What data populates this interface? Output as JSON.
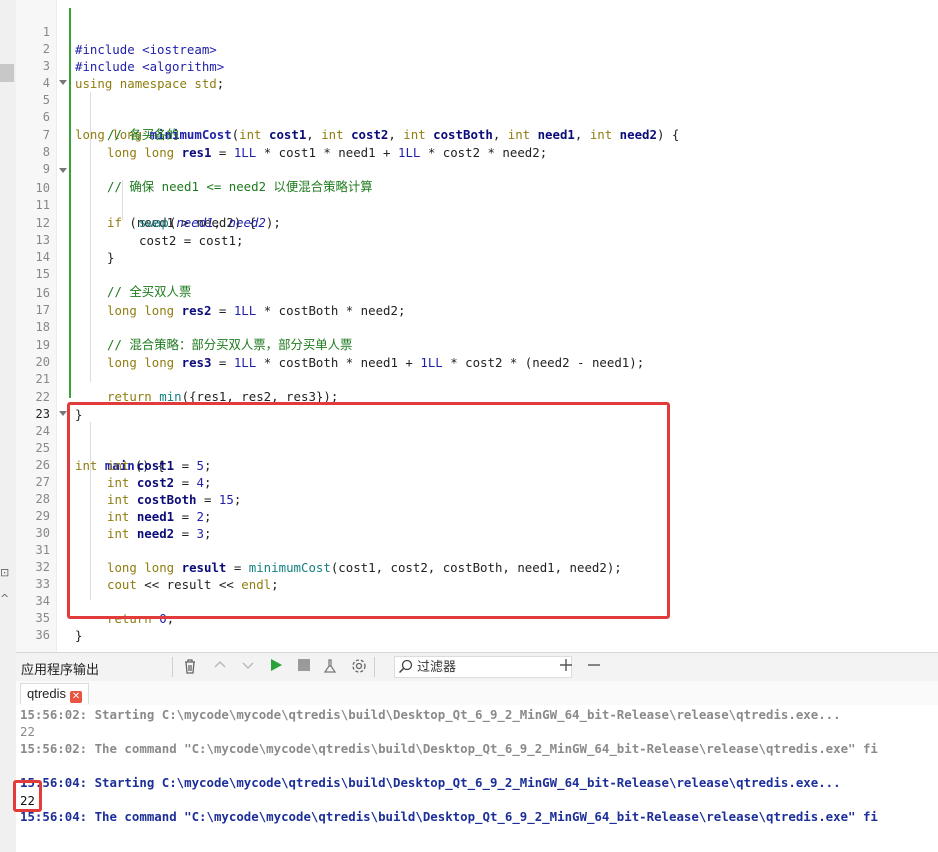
{
  "editor": {
    "current_line": 23,
    "line_numbers": [
      "1",
      "2",
      "3",
      "4",
      "5",
      "6",
      "7",
      "8",
      "9",
      "10",
      "11",
      "12",
      "13",
      "14",
      "15",
      "16",
      "17",
      "18",
      "19",
      "20",
      "21",
      "22",
      "23",
      "24",
      "25",
      "26",
      "27",
      "28",
      "29",
      "30",
      "31",
      "32",
      "33",
      "34",
      "35",
      "36"
    ],
    "code": {
      "l1": "#include <iostream>",
      "l2": "#include <algorithm>",
      "l3_a": "using",
      "l3_b": " ",
      "l3_c": "namespace",
      "l3_d": " ",
      "l3_e": "std",
      "l3_f": ";",
      "l5_a": "long long ",
      "l5_b": "minimumCost",
      "l5_c": "(",
      "l5_d": "int ",
      "l5_e": "cost1",
      "l5_f": ", ",
      "l5_g": "int ",
      "l5_h": "cost2",
      "l5_i": ", ",
      "l5_j": "int ",
      "l5_k": "costBoth",
      "l5_l": ", ",
      "l5_m": "int ",
      "l5_n": "need1",
      "l5_o": ", ",
      "l5_p": "int ",
      "l5_q": "need2",
      "l5_r": ") {",
      "l6": "// 各买各的",
      "l7_a": "long long ",
      "l7_b": "res1",
      "l7_c": " = ",
      "l7_d": "1LL",
      "l7_e": " * cost1 * need1 + ",
      "l7_f": "1LL",
      "l7_g": " * cost2 * need2;",
      "l9": "// 确保 need1 <= need2 以便混合策略计算",
      "l10_a": "if",
      "l10_b": " (need1 > need2) {",
      "l11_a": "swap",
      "l11_b": "(",
      "l11_c": "need1",
      "l11_d": ", ",
      "l11_e": "need2",
      "l11_f": ");",
      "l12": "cost2 = cost1;",
      "l13": "}",
      "l15": "// 全买双人票",
      "l16_a": "long long ",
      "l16_b": "res2",
      "l16_c": " = ",
      "l16_d": "1LL",
      "l16_e": " * costBoth * need2;",
      "l18": "// 混合策略：部分买双人票，部分买单人票",
      "l19_a": "long long ",
      "l19_b": "res3",
      "l19_c": " = ",
      "l19_d": "1LL",
      "l19_e": " * costBoth * need1 + ",
      "l19_f": "1LL",
      "l19_g": " * cost2 * (need2 - need1);",
      "l21_a": "return",
      "l21_b": " ",
      "l21_c": "min",
      "l21_d": "({res1, res2, res3});",
      "l22": "}",
      "l24_a": "int ",
      "l24_b": "main",
      "l24_c": "() {",
      "l25_a": "int ",
      "l25_b": "cost1",
      "l25_c": " = ",
      "l25_d": "5",
      "l25_e": ";",
      "l26_a": "int ",
      "l26_b": "cost2",
      "l26_c": " = ",
      "l26_d": "4",
      "l26_e": ";",
      "l27_a": "int ",
      "l27_b": "costBoth",
      "l27_c": " = ",
      "l27_d": "15",
      "l27_e": ";",
      "l28_a": "int ",
      "l28_b": "need1",
      "l28_c": " = ",
      "l28_d": "2",
      "l28_e": ";",
      "l29_a": "int ",
      "l29_b": "need2",
      "l29_c": " = ",
      "l29_d": "3",
      "l29_e": ";",
      "l31_a": "long long ",
      "l31_b": "result",
      "l31_c": " = ",
      "l31_d": "minimumCost",
      "l31_e": "(cost1, cost2, costBoth, need1, need2);",
      "l32_a": "cout",
      "l32_b": " << result << ",
      "l32_c": "endl",
      "l32_d": ";",
      "l34_a": "return",
      "l34_b": " ",
      "l34_c": "0",
      "l34_d": ";",
      "l35": "}"
    }
  },
  "output_panel": {
    "title": "应用程序输出",
    "filter_placeholder": "过滤器",
    "tab_label": "qtredis",
    "tab_close": "✕",
    "lines": [
      "15:56:02: Starting C:\\mycode\\mycode\\qtredis\\build\\Desktop_Qt_6_9_2_MinGW_64_bit-Release\\release\\qtredis.exe...",
      "22",
      "15:56:02: The command \"C:\\mycode\\mycode\\qtredis\\build\\Desktop_Qt_6_9_2_MinGW_64_bit-Release\\release\\qtredis.exe\" fi",
      "",
      "15:56:04: Starting C:\\mycode\\mycode\\qtredis\\build\\Desktop_Qt_6_9_2_MinGW_64_bit-Release\\release\\qtredis.exe...",
      "22",
      "15:56:04: The command \"C:\\mycode\\mycode\\qtredis\\build\\Desktop_Qt_6_9_2_MinGW_64_bit-Release\\release\\qtredis.exe\" fi"
    ]
  },
  "toolbar_icons": [
    "trash-icon",
    "up-arrow-icon",
    "down-arrow-icon",
    "run-icon",
    "stop-icon",
    "clean-icon",
    "settings-icon",
    "search-icon",
    "plus-icon",
    "minus-icon"
  ],
  "colors": {
    "highlight": "#e23b3b",
    "run_green": "#27a33a",
    "changebar": "#39a33a"
  },
  "left_strip": {
    "glyph_1": "⊡",
    "glyph_2": "^"
  }
}
